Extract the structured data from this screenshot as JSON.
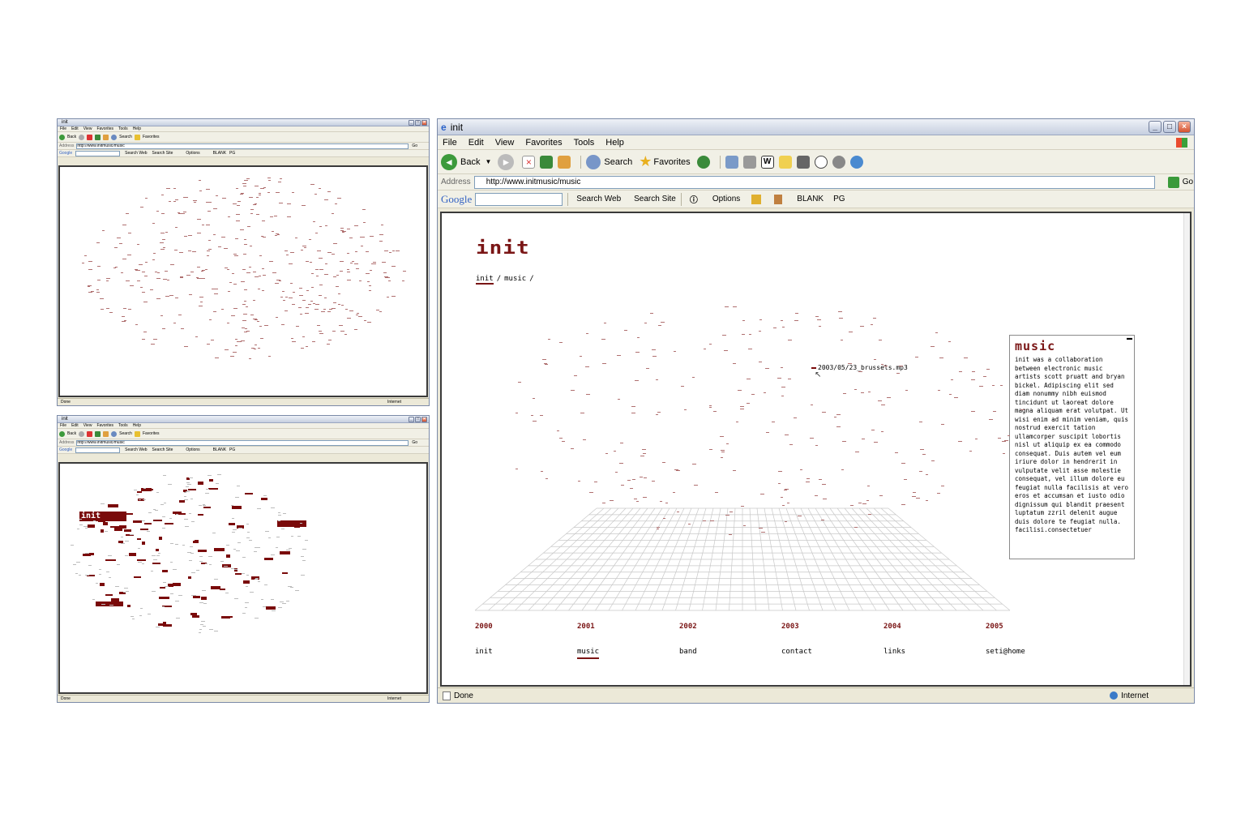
{
  "window": {
    "title": "init"
  },
  "menu": [
    "File",
    "Edit",
    "View",
    "Favorites",
    "Tools",
    "Help"
  ],
  "toolbar": {
    "back": "Back",
    "search": "Search",
    "favorites": "Favorites"
  },
  "address": {
    "label": "Address",
    "url_main": "http://www.initmusic/music",
    "url_small": "http://www.initmusic/music",
    "go": "Go"
  },
  "google_bar": {
    "brand": "Google",
    "search_web": "Search Web",
    "search_site": "Search Site",
    "options": "Options",
    "blank": "BLANK",
    "pg": "PG"
  },
  "page": {
    "logo": "init",
    "breadcrumb": [
      "init",
      "/",
      "music",
      "/"
    ],
    "hover_track": "2003/05/23_brussels.mp3",
    "panel_title": "music",
    "panel_text": "init was a collaboration between electronic music artists scott pruatt and bryan bickel. Adipiscing elit sed diam nonummy nibh euismod tincidunt ut laoreat dolore magna aliquam erat volutpat. Ut wisi enim ad minim veniam, quis nostrud exercit tation ullamcorper suscipit lobortis nisl ut aliquip ex ea commodo consequat. Duis autem vel eum iriure dolor in hendrerit in vulputate velit asse molestie consequat, vel illum dolore eu feugiat nulla facilisis at vero eros et accumsan et iusto odio dignissum qui blandit praesent luptatum zzril delenit augue duis dolore te feugiat nulla. facilisi.consectetuer",
    "years": [
      "2000",
      "2001",
      "2002",
      "2003",
      "2004",
      "2005"
    ],
    "nav": [
      "init",
      "music",
      "band",
      "contact",
      "links",
      "seti@home"
    ],
    "active_nav": "music"
  },
  "status": {
    "left": "Done",
    "right": "Internet"
  },
  "colors": {
    "accent": "#7a1515",
    "dots": "#b07070"
  }
}
